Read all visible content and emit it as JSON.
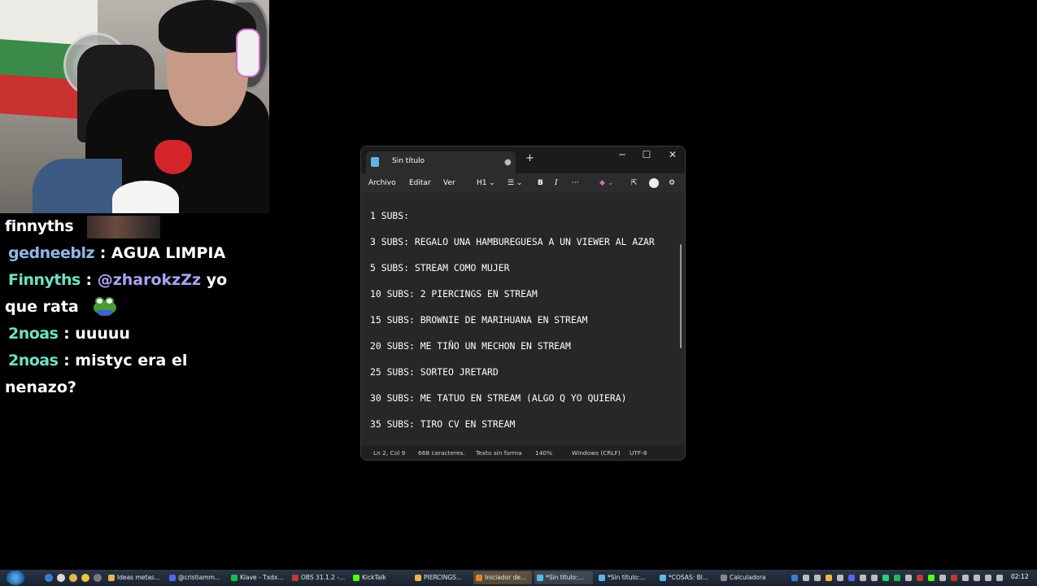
{
  "chat": {
    "lines": [
      {
        "user": "finnyths",
        "message": ""
      },
      {
        "user": "gedneeblz",
        "message": "AGUA LIMPIA"
      },
      {
        "user": "Finnyths",
        "mention": "@zharokzZz",
        "message": "yo",
        "continuation": "que rata"
      },
      {
        "user": "2noas",
        "message": "uuuuu"
      },
      {
        "user": "2noas",
        "message": "mistyc era el",
        "continuation": "nenazo?"
      }
    ],
    "separator": ":",
    "emotes": [
      "avatar-strip",
      "frog-emote"
    ]
  },
  "notepad": {
    "tab_title": "Sin título",
    "tab_modified_dot": "●",
    "new_tab": "+",
    "window_controls": {
      "minimize": "─",
      "maximize": "☐",
      "close": "✕"
    },
    "menu": {
      "archivo": "Archivo",
      "editar": "Editar",
      "ver": "Ver",
      "heading": "H1 ⌄",
      "list": "☰ ⌄",
      "bold": "B",
      "italic": "I",
      "more": "···",
      "copilot": "◆ ⌄",
      "share": "⇱",
      "settings": "⚙"
    },
    "lines": [
      "1 SUBS:",
      "3 SUBS: REGALO UNA HAMBUREGUESA A UN VIEWER AL AZAR",
      "5 SUBS: STREAM COMO MUJER",
      "10 SUBS: 2 PIERCINGS EN STREAM",
      "15 SUBS: BROWNIE DE MARIHUANA EN STREAM",
      "20 SUBS: ME TIÑO UN MECHON EN STREAM",
      "25 SUBS: SORTEO JRETARD",
      "30 SUBS: ME TATUO EN STREAM (ALGO Q YO QUIERA)",
      "35 SUBS: TIRO CV EN STREAM"
    ],
    "status": {
      "position": "Ln 2, Col 9",
      "characters": "668 caracteres.",
      "format": "Texto sin forma",
      "zoom": "140%",
      "line_endings": "Windows (CRLF)",
      "encoding": "UTF-8"
    }
  },
  "taskbar": {
    "tasks": [
      {
        "label": "Ideas metas...",
        "icon": "chrome-icon",
        "color": "#e9b54a"
      },
      {
        "label": "@cristiamm...",
        "icon": "discord-icon",
        "color": "#5865f2"
      },
      {
        "label": "Klave - Txdx...",
        "icon": "spotify-icon",
        "color": "#1db954"
      },
      {
        "label": "OBS 31.1.2 -...",
        "icon": "obs-icon",
        "color": "#c0392b"
      },
      {
        "label": "KickTalk",
        "icon": "kick-icon",
        "color": "#53fc18"
      },
      {
        "label": "PIERCINGS...",
        "icon": "chrome-icon",
        "color": "#e9b54a"
      },
      {
        "label": "Iniciador de...",
        "icon": "launcher-icon",
        "color": "#e2842a"
      },
      {
        "label": "*Sin título:...",
        "icon": "notepad-icon",
        "color": "#5db6e8"
      },
      {
        "label": "*Sin título:...",
        "icon": "notepad-icon",
        "color": "#5db6e8"
      },
      {
        "label": "*COSAS: Bl...",
        "icon": "notepad-icon",
        "color": "#5db6e8"
      },
      {
        "label": "Calculadora",
        "icon": "calculator-icon",
        "color": "#8a8a8a"
      }
    ],
    "clock": "02:12"
  }
}
